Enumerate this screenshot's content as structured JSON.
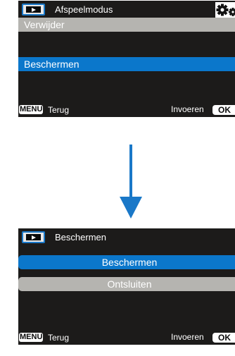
{
  "screen_top": {
    "title": "Afspeelmodus",
    "menu_items": [
      {
        "label": "Verwijder",
        "state": "normal"
      },
      {
        "label": "Beschermen",
        "state": "selected"
      }
    ],
    "footer": {
      "menu_key": "MENU",
      "back_label": "Terug",
      "enter_label": "Invoeren",
      "ok_key": "OK"
    },
    "icons": [
      "play-icon",
      "gear-icon"
    ]
  },
  "transition": {
    "icon": "arrow-down-icon"
  },
  "screen_bottom": {
    "title": "Beschermen",
    "menu_items": [
      {
        "label": "Beschermen",
        "state": "selected"
      },
      {
        "label": "Ontsluiten",
        "state": "normal"
      }
    ],
    "footer": {
      "menu_key": "MENU",
      "back_label": "Terug",
      "enter_label": "Invoeren",
      "ok_key": "OK"
    },
    "icons": [
      "play-icon"
    ]
  },
  "colors": {
    "screen_bg": "#1c1b1a",
    "highlight": "#0b77cb",
    "item_normal": "#b5b4b0",
    "arrow": "#1a78c8"
  }
}
